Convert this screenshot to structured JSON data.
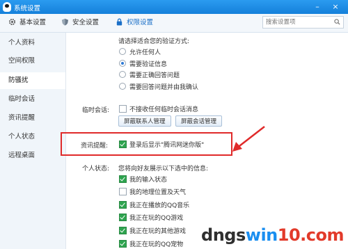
{
  "window": {
    "title": "系统设置"
  },
  "tabs": [
    {
      "label": "基本设置",
      "icon": "gear-icon"
    },
    {
      "label": "安全设置",
      "icon": "shield-icon"
    },
    {
      "label": "权限设置",
      "icon": "lock-icon",
      "active": true
    }
  ],
  "search": {
    "placeholder": "搜索设置项"
  },
  "sidebar": {
    "items": [
      {
        "label": "个人资料"
      },
      {
        "label": "空间权限"
      },
      {
        "label": "防骚扰",
        "active": true
      },
      {
        "label": "临时会话"
      },
      {
        "label": "资讯提醒"
      },
      {
        "label": "个人状态"
      },
      {
        "label": "远程桌面"
      }
    ]
  },
  "verify": {
    "prompt": "请选择适合您的验证方式:",
    "options": [
      {
        "label": "允许任何人",
        "selected": false
      },
      {
        "label": "需要验证信息",
        "selected": true
      },
      {
        "label": "需要正确回答问题",
        "selected": false
      },
      {
        "label": "需要回答问题并由我确认",
        "selected": false
      }
    ]
  },
  "temp_session": {
    "label": "临时会话:",
    "checkbox_label": "不接收任何临时会话消息",
    "checked": false,
    "buttons": [
      "屏蔽联系人管理",
      "屏蔽会话管理"
    ]
  },
  "news": {
    "label": "资讯提醒:",
    "checkbox_label": "登录后显示\"腾讯网迷你版\"",
    "checked": true
  },
  "status": {
    "label": "个人状态:",
    "description": "您将向好友展示以下选中的信息:",
    "items": [
      {
        "label": "我的输入状态",
        "checked": true
      },
      {
        "label": "我的地理位置及天气",
        "checked": false
      },
      {
        "label": "我正在播放的QQ音乐",
        "checked": true
      },
      {
        "label": "我正在玩的QQ游戏",
        "checked": true
      },
      {
        "label": "我正在玩的其他游戏",
        "checked": true
      },
      {
        "label": "我正在玩的QQ宠物",
        "checked": true
      }
    ]
  },
  "watermark": {
    "part1": "dngs",
    "part2": "win",
    "part3": "10.com"
  },
  "colors": {
    "accent": "#1a80da",
    "highlight": "#e02a2a",
    "check": "#2ea44f"
  }
}
